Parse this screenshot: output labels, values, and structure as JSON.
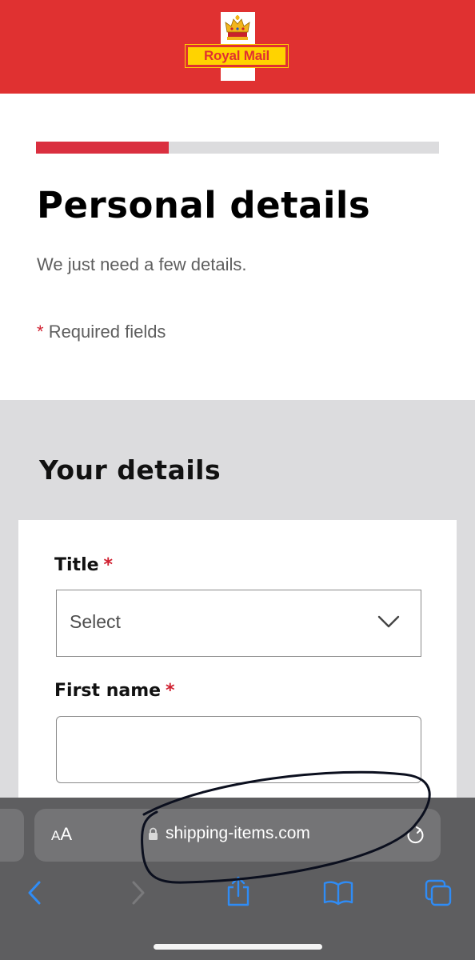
{
  "header": {
    "logo_text": "Royal Mail",
    "brand_red": "#e03131",
    "brand_yellow": "#ffd300",
    "crown_icon": "crown-icon"
  },
  "progress": {
    "value": 0.33,
    "fill_color": "#da2f3f",
    "track_color": "#dcdcde"
  },
  "page": {
    "title": "Personal details",
    "subtitle": "We just need a few details.",
    "required_star": "*",
    "required_note": "Required fields"
  },
  "section": {
    "title": "Your details",
    "background": "#dcdcde"
  },
  "form": {
    "title_label": "Title",
    "title_select_value": "Select",
    "first_name_label": "First name",
    "first_name_value": "",
    "required_star": "*"
  },
  "browser": {
    "text_size_button": {
      "small": "A",
      "large": "A"
    },
    "url": "shipping-items.com",
    "icons": [
      "lock-icon",
      "reload-icon",
      "back-icon",
      "forward-icon",
      "share-icon",
      "bookmarks-icon",
      "tabs-icon"
    ],
    "accent": "#2f8cf6"
  }
}
